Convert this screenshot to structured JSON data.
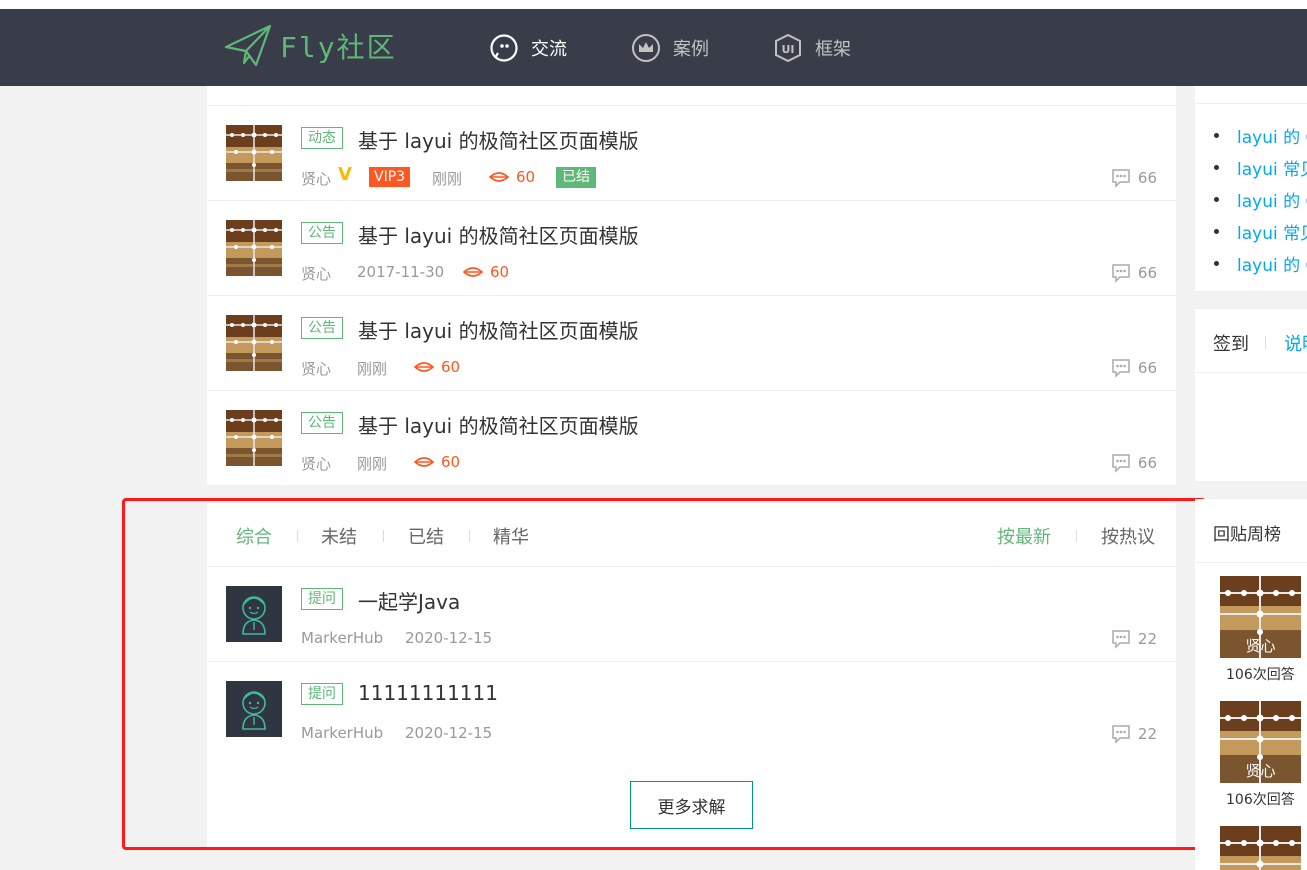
{
  "header": {
    "logo_text": "Fly社区",
    "nav": [
      {
        "label": "交流",
        "icon": "chat-icon"
      },
      {
        "label": "案例",
        "icon": "crown-icon"
      },
      {
        "label": "框架",
        "icon": "ui-icon"
      }
    ]
  },
  "posts": [
    {
      "badge": "动态",
      "title": "基于 layui 的极简社区页面模版",
      "author": "贤心",
      "vip": "VIP3",
      "time": "刚刚",
      "views": "60",
      "status": "已结",
      "replies": "66"
    },
    {
      "badge": "公告",
      "title": "基于 layui 的极简社区页面模版",
      "author": "贤心",
      "time": "2017-11-30",
      "views": "60",
      "replies": "66"
    },
    {
      "badge": "公告",
      "title": "基于 layui 的极简社区页面模版",
      "author": "贤心",
      "time": "刚刚",
      "views": "60",
      "replies": "66"
    },
    {
      "badge": "公告",
      "title": "基于 layui 的极简社区页面模版",
      "author": "贤心",
      "time": "刚刚",
      "views": "60",
      "replies": "66"
    }
  ],
  "filter": {
    "tabs": [
      "综合",
      "未结",
      "已结",
      "精华"
    ],
    "sort": [
      "按最新",
      "按热议"
    ]
  },
  "questions": [
    {
      "badge": "提问",
      "title": "一起学Java",
      "author": "MarkerHub",
      "date": "2020-12-15",
      "replies": "22"
    },
    {
      "badge": "提问",
      "title": "11111111111",
      "author": "MarkerHub",
      "date": "2020-12-15",
      "replies": "22"
    }
  ],
  "more_button": "更多求解",
  "sidebar": {
    "links": [
      "layui 的 G",
      "layui 常见",
      "layui 的 G",
      "layui 常见",
      "layui 的 G"
    ],
    "signin_tab": "签到",
    "signin_help": "说明",
    "rank_title": "回贴周榜",
    "rank": [
      {
        "name": "贤心",
        "count": "106次回答"
      },
      {
        "name": "贤心",
        "count": "106次回答"
      }
    ]
  },
  "colors": {
    "header_bg": "#393d49",
    "accent_green": "#5fb878",
    "accent_red": "#ff5722",
    "link_blue": "#01aaed",
    "highlight_box": "#ff1a1a"
  }
}
